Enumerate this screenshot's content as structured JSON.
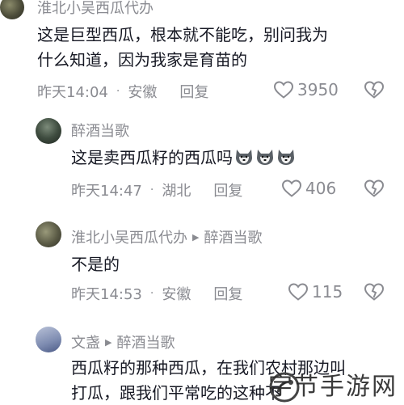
{
  "comments": [
    {
      "user": "淮北小吴西瓜代办",
      "reply_to": "",
      "text_lines": [
        "这是巨型西瓜，根本就不能吃，别问我为",
        "什么知道，因为我家是育苗的"
      ],
      "time": "昨天14:04",
      "location": "安徽",
      "reply_label": "回复",
      "likes": "3950",
      "like_icon": "heart-outline-icon",
      "dislike_icon": "broken-heart-icon"
    },
    {
      "user": "醉酒当歌",
      "reply_to": "",
      "text_lines": [
        "这是卖西瓜籽的西瓜吗"
      ],
      "emoji": "husky-dog-emoji",
      "time": "昨天14:47",
      "location": "湖北",
      "reply_label": "回复",
      "likes": "406"
    },
    {
      "user": "淮北小吴西瓜代办",
      "reply_to": "醉酒当歌",
      "text_lines": [
        "不是的"
      ],
      "time": "昨天14:53",
      "location": "安徽",
      "reply_label": "回复",
      "likes": "115"
    },
    {
      "user": "文盏",
      "reply_to": "醉酒当歌",
      "text_lines": [
        "西瓜籽的那种西瓜，在我们农村那边叫",
        "打瓜，跟我们平常吃的这种不"
      ],
      "time": "",
      "location": "",
      "reply_label": "",
      "likes": ""
    }
  ],
  "watermark": {
    "text": "字节手游网"
  },
  "colors": {
    "text": "#161823",
    "muted": "#8a8b91",
    "background": "#ffffff"
  }
}
